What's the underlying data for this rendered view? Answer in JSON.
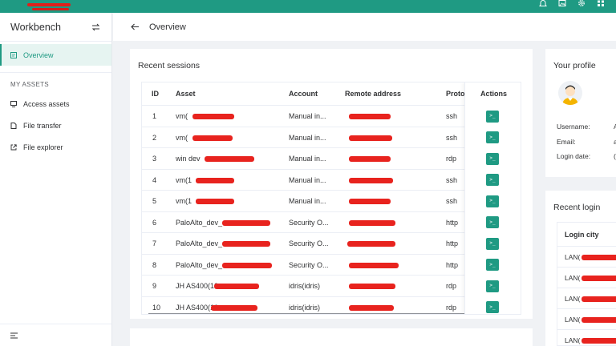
{
  "sidebar": {
    "title": "Workbench",
    "items": [
      {
        "label": "Overview"
      },
      {
        "label": "Access assets"
      },
      {
        "label": "File transfer"
      },
      {
        "label": "File explorer"
      }
    ],
    "section": "MY ASSETS"
  },
  "header": {
    "title": "Overview"
  },
  "sessions": {
    "title": "Recent sessions",
    "columns": [
      "ID",
      "Asset",
      "Account",
      "Remote address",
      "Proto",
      "Actions"
    ],
    "rows": [
      {
        "id": "1",
        "asset": "vm(",
        "account": "Manual in...",
        "proto": "ssh"
      },
      {
        "id": "2",
        "asset": "vm(",
        "account": "Manual in...",
        "proto": "ssh"
      },
      {
        "id": "3",
        "asset": "win dev",
        "account": "Manual in...",
        "proto": "rdp"
      },
      {
        "id": "4",
        "asset": "vm(1",
        "account": "Manual in...",
        "proto": "ssh"
      },
      {
        "id": "5",
        "asset": "vm(1",
        "account": "Manual in...",
        "proto": "ssh"
      },
      {
        "id": "6",
        "asset": "PaloAlto_dev_",
        "account": "Security O...",
        "proto": "http"
      },
      {
        "id": "7",
        "asset": "PaloAlto_dev_",
        "account": "Security O...",
        "proto": "http"
      },
      {
        "id": "8",
        "asset": "PaloAlto_dev_",
        "account": "Security O...",
        "proto": "http"
      },
      {
        "id": "9",
        "asset": "JH AS400(10",
        "account": "idris(idris)",
        "proto": "rdp"
      },
      {
        "id": "10",
        "asset": "JH AS400(10",
        "account": "idris(idris)",
        "proto": "rdp"
      }
    ],
    "action_glyph": ">_"
  },
  "profile": {
    "title": "Your profile",
    "fields": [
      {
        "label": "Username:",
        "value": "A"
      },
      {
        "label": "Email:",
        "value": "a"
      },
      {
        "label": "Login date:",
        "value": "("
      }
    ]
  },
  "recent_login": {
    "title": "Recent login",
    "column": "Login city",
    "rows": [
      "LAN(",
      "LAN(",
      "LAN(",
      "LAN(",
      "LAN("
    ]
  },
  "colors": {
    "accent": "#1f9a83",
    "redaction": "#e8231e"
  }
}
